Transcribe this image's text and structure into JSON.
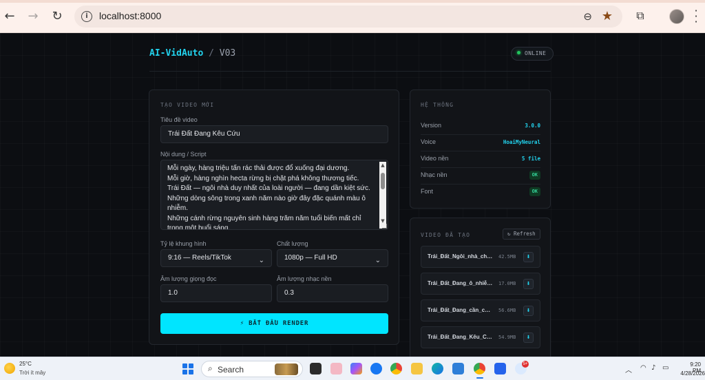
{
  "browser": {
    "url": "localhost:8000"
  },
  "header": {
    "brand": "AI-VidAuto",
    "separator": "/",
    "version": "V03",
    "status": "ONLINE"
  },
  "create_panel": {
    "title": "TẠO VIDEO MỚI",
    "title_label": "Tiêu đề video",
    "title_value": "Trái Đất Đang Kêu Cứu",
    "script_label": "Nội dung / Script",
    "script_lines": [
      "Mỗi ngày, hàng triệu tấn rác thải được đổ xuống đại dương.",
      "Mỗi giờ, hàng nghìn hecta rừng bị chặt phá không thương tiếc.",
      "Trái Đất — ngôi nhà duy nhất của loài người — đang dần kiệt sức.",
      "Những dòng sông trong xanh năm nào giờ đây đặc quánh màu ô nhiễm.",
      "Những cánh rừng nguyên sinh hàng trăm năm tuổi biến mất chỉ trong một buổi sáng."
    ],
    "aspect_label": "Tỷ lệ khung hình",
    "aspect_value": "9:16 — Reels/TikTok",
    "quality_label": "Chất lượng",
    "quality_value": "1080p — Full HD",
    "voice_volume_label": "Âm lượng giọng đọc",
    "voice_volume_value": "1.0",
    "music_volume_label": "Âm lượng nhạc nền",
    "music_volume_value": "0.3",
    "render_button": "⚡ BẮT ĐẦU RENDER"
  },
  "system_panel": {
    "title": "HỆ THỐNG",
    "rows": [
      {
        "label": "Version",
        "value": "3.0.0"
      },
      {
        "label": "Voice",
        "value": "HoaiMyNeural"
      },
      {
        "label": "Video nền",
        "value": "5 file"
      },
      {
        "label": "Nhạc nền",
        "value": "OK"
      },
      {
        "label": "Font",
        "value": "OK"
      }
    ]
  },
  "videos_panel": {
    "title": "VIDEO ĐÃ TẠO",
    "refresh_label": "↻ Refresh",
    "items": [
      {
        "name": "Trái_Đất_Ngôi_nhà_ch…",
        "size": "42.5MB"
      },
      {
        "name": "Trái_Đất_Đang_ô_nhiễ…",
        "size": "17.0MB"
      },
      {
        "name": "Trái_Đất_Đang_cần_c…",
        "size": "56.6MB"
      },
      {
        "name": "Trái_Đất_Đang_Kêu_C…",
        "size": "54.9MB"
      }
    ]
  },
  "taskbar": {
    "weather_temp": "25°C",
    "weather_desc": "Trời ít mây",
    "search_label": "Search",
    "notification_count": "5+",
    "time": "9:20 PM",
    "date": "4/28/2026"
  }
}
